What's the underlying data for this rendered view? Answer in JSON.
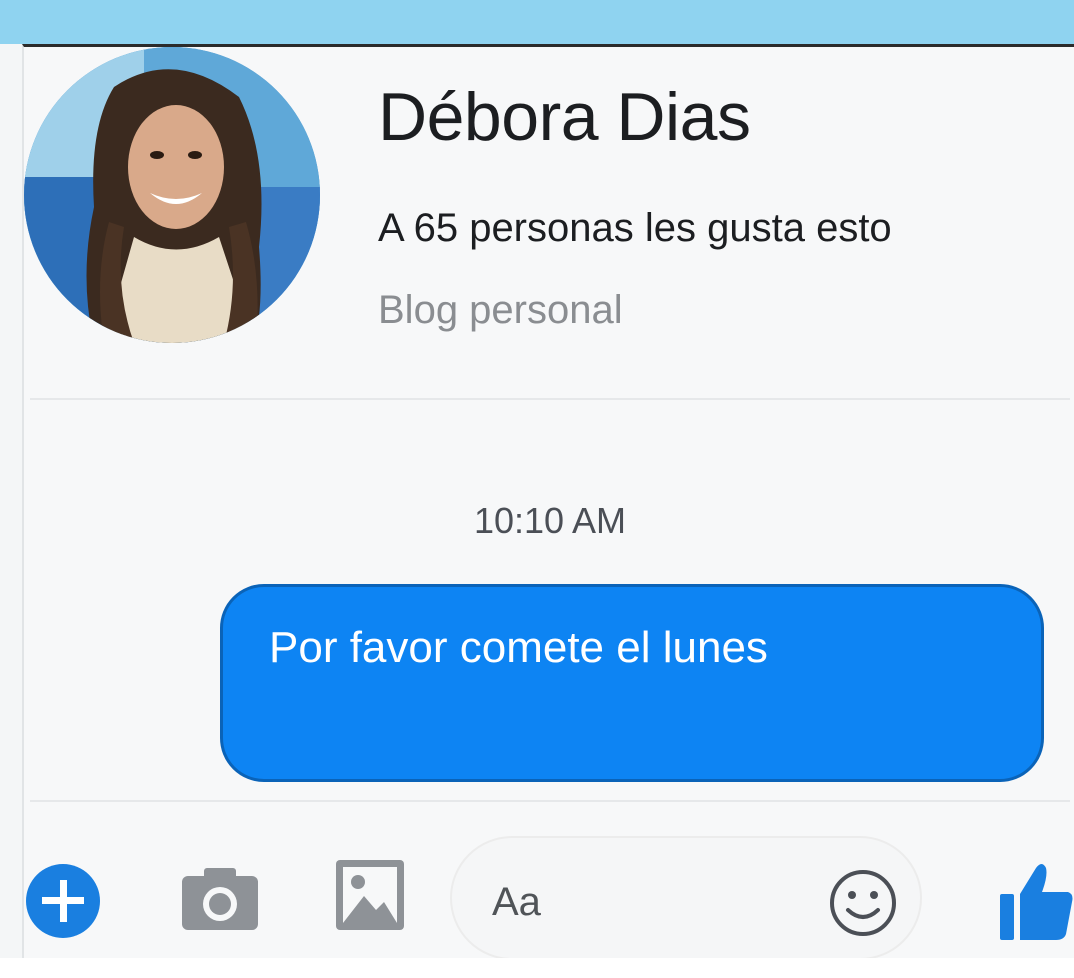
{
  "header": {
    "name": "Débora Dias",
    "likes_text": "A 65 personas les gusta esto",
    "category": "Blog personal"
  },
  "conversation": {
    "timestamp": "10:10 AM",
    "messages": [
      {
        "sender": "self",
        "text": "Por favor comete el lunes"
      }
    ]
  },
  "composer": {
    "placeholder": "Aa",
    "icons": [
      "plus-icon",
      "camera-icon",
      "image-icon",
      "emoji-icon",
      "like-icon"
    ]
  },
  "colors": {
    "accent": "#0d84f3",
    "top_bar": "#8fd3f0",
    "text_primary": "#1c1e21",
    "text_secondary": "#8a8d91"
  }
}
